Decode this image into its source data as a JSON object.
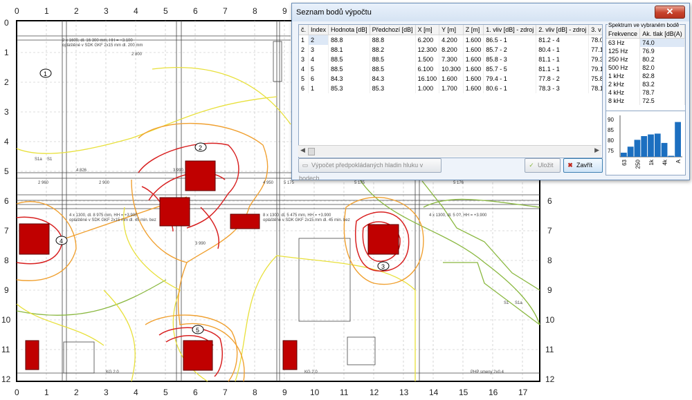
{
  "map": {
    "x_ruler_top": [
      "0",
      "1",
      "2",
      "3",
      "4",
      "5",
      "6",
      "7",
      "8",
      "9"
    ],
    "x_ruler_bottom": [
      "0",
      "1",
      "2",
      "3",
      "4",
      "5",
      "6",
      "7",
      "8",
      "9",
      "10",
      "11",
      "12",
      "13",
      "14",
      "15",
      "16",
      "17"
    ],
    "y_ruler_left": [
      "0",
      "1",
      "2",
      "3",
      "4",
      "5",
      "6",
      "7",
      "8",
      "9",
      "10",
      "11",
      "12"
    ],
    "y_ruler_right": [
      "6",
      "7",
      "8",
      "9",
      "10",
      "11",
      "12"
    ],
    "point_markers": [
      "1",
      "2",
      "3",
      "4",
      "5"
    ],
    "room_labels": [
      "S1a",
      "S1",
      "S1",
      "S1a",
      "KG 2.0",
      "KG 2.0",
      "PHP smeny 2x0.4"
    ],
    "dim_labels": [
      "2 960",
      "2 900",
      "5 175",
      "5 176",
      "4 826",
      "3 990",
      "4 950",
      "5 175",
      "3 990",
      "2 800"
    ],
    "notes": [
      "2 x 1600, dl. 16 300 mm, HH = +3.100",
      "opláštěné v SDK GKF 2x15 mm dl. 200 mm",
      "4 x 1300, dl. 8 975 mm, HH = +3.900",
      "opláštěné v SDK GKF 2x15 mm dl. 45 min. bez",
      "8 x 1300, dl. 5 475 mm, HH = +3.900",
      "opláštěné v SDK GKF 2x15 mm dl. 45 min. bez",
      "4 x 1300, dl. 5 0?, HH = +3.900"
    ],
    "colors": {
      "contour_yellow": "#e8e03a",
      "contour_orange": "#f0a030",
      "contour_red": "#d82020",
      "contour_green": "#8ab840",
      "source_fill": "#c00000"
    }
  },
  "dialog": {
    "title": "Seznam bodů výpočtu",
    "close_icon": "close-x",
    "columns": [
      "č.",
      "Index",
      "Hodnota [dB]",
      "Předchozí [dB]",
      "X [m]",
      "Y [m]",
      "Z [m]",
      "1. vliv [dB] - zdroj",
      "2. vliv [dB] - zdroj",
      "3. v"
    ],
    "rows": [
      [
        "1",
        "2",
        "88.8",
        "88.8",
        "6.200",
        "4.200",
        "1.600",
        "86.5 - 1",
        "81.2 - 4",
        "78.0"
      ],
      [
        "2",
        "3",
        "88.1",
        "88.2",
        "12.300",
        "8.200",
        "1.600",
        "85.7 - 2",
        "80.4 - 1",
        "77.1"
      ],
      [
        "3",
        "4",
        "88.5",
        "88.5",
        "1.500",
        "7.300",
        "1.600",
        "85.8 - 3",
        "81.1 - 1",
        "79.3"
      ],
      [
        "4",
        "5",
        "88.5",
        "88.5",
        "6.100",
        "10.300",
        "1.600",
        "85.7 - 5",
        "81.1 - 1",
        "79.1"
      ],
      [
        "5",
        "6",
        "84.3",
        "84.3",
        "16.100",
        "1.600",
        "1.600",
        "79.4 - 1",
        "77.8 - 2",
        "75.8"
      ],
      [
        "6",
        "1",
        "85.3",
        "85.3",
        "1.000",
        "1.700",
        "1.600",
        "80.6 - 1",
        "78.3 - 3",
        "78.1"
      ]
    ],
    "calc_button": "Výpočet předpokládaných hladin hluku v bodech",
    "save_button": "Uložit",
    "close_button": "Zavřít",
    "spectrum": {
      "title": "Spektrum ve vybraném bodě",
      "columns": [
        "Frekvence",
        "Ak. tlak [dB(A)"
      ],
      "rows": [
        [
          "63 Hz",
          "74.0"
        ],
        [
          "125 Hz",
          "76.9"
        ],
        [
          "250 Hz",
          "80.2"
        ],
        [
          "500 Hz",
          "82.0"
        ],
        [
          "1 kHz",
          "82.8"
        ],
        [
          "2 kHz",
          "83.2"
        ],
        [
          "4 kHz",
          "78.7"
        ],
        [
          "8 kHz",
          "72.5"
        ]
      ]
    }
  },
  "chart_data": {
    "type": "bar",
    "categories": [
      "63",
      "125",
      "250",
      "500",
      "1k",
      "2k",
      "4k",
      "8k",
      "A"
    ],
    "values": [
      74.0,
      76.9,
      80.2,
      82.0,
      82.8,
      83.2,
      78.7,
      72.5,
      88.8
    ],
    "tick_labels_x": [
      "63",
      "250",
      "1k",
      "4k",
      "A"
    ],
    "yticks": [
      "90",
      "85",
      "80",
      "75"
    ],
    "ylim": [
      72,
      92
    ],
    "bar_color": "#1c6fc0"
  }
}
